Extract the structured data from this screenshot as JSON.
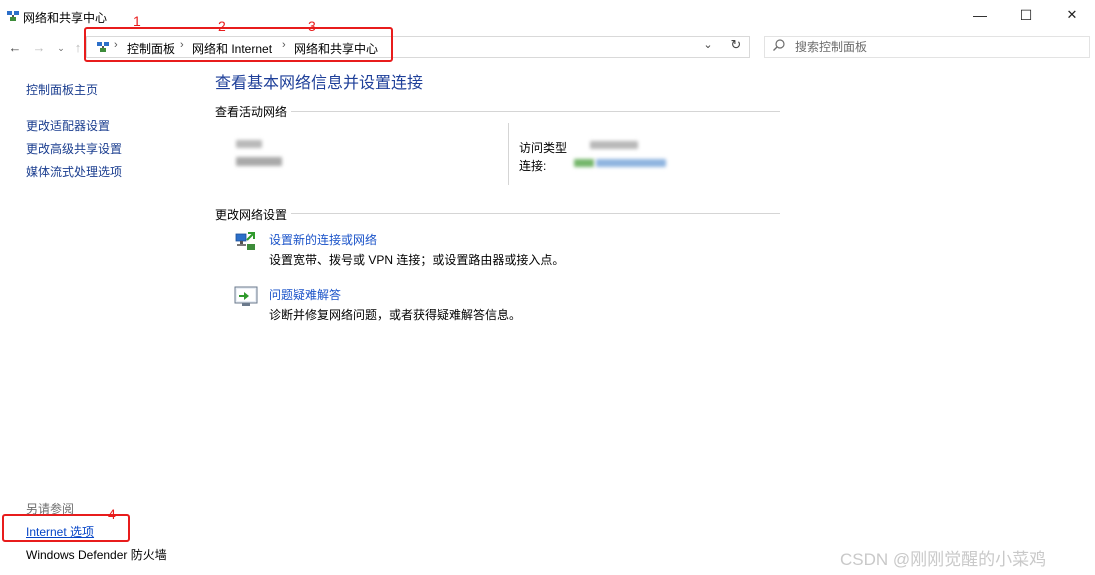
{
  "window": {
    "title": "网络和共享中心",
    "minimize_glyph": "—",
    "maximize_glyph": "☐",
    "close_glyph": "✕"
  },
  "navigation": {
    "back_glyph": "←",
    "forward_glyph": "→",
    "recent_glyph": "⌄",
    "up_glyph": "↑",
    "breadcrumb": [
      "控制面板",
      "网络和 Internet",
      "网络和共享中心"
    ],
    "separator": "›",
    "dropdown_glyph": "⌄",
    "refresh_glyph": "↻"
  },
  "search": {
    "placeholder": "搜索控制面板",
    "icon": "search-icon"
  },
  "sidebar": {
    "home": "控制面板主页",
    "items": [
      "更改适配器设置",
      "更改高级共享设置",
      "媒体流式处理选项"
    ],
    "see_also_label": "另请参阅",
    "see_also": [
      "Internet 选项",
      "Windows Defender 防火墙"
    ]
  },
  "main": {
    "heading": "查看基本网络信息并设置连接",
    "active_networks_header": "查看活动网络",
    "access_type_label": "访问类型",
    "connection_label": "连接:",
    "change_settings_header": "更改网络设置",
    "tasks": [
      {
        "link": "设置新的连接或网络",
        "description": "设置宽带、拨号或 VPN 连接；或设置路由器或接入点。",
        "icon": "network-setup-icon"
      },
      {
        "link": "问题疑难解答",
        "description": "诊断并修复网络问题，或者获得疑难解答信息。",
        "icon": "troubleshoot-icon"
      }
    ]
  },
  "annotations": {
    "numbers": [
      "1",
      "2",
      "3",
      "4"
    ],
    "color": "#e81c1c"
  },
  "watermark": "CSDN @刚刚觉醒的小菜鸡",
  "colors": {
    "link": "#1a3d8f",
    "heading": "#1e3f99",
    "active_link": "#0645c7"
  }
}
